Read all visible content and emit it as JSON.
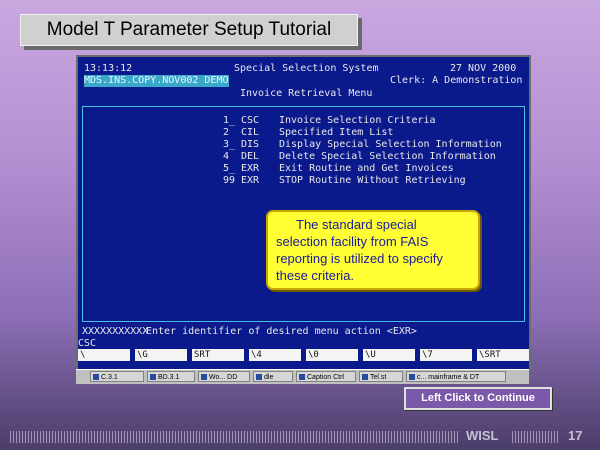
{
  "slide": {
    "title": "Model T Parameter Setup Tutorial",
    "continue_label": "Left Click to Continue",
    "footer_org": "WISL",
    "page_number": "17"
  },
  "terminal": {
    "time": "13:13:12",
    "system_title": "Special Selection System",
    "date": "27 NOV 2000",
    "session": "MDS.INS.COPY.NOV002 DEMO",
    "clerk": "Clerk: A Demonstration",
    "screen_title": "Invoice Retrieval Menu",
    "menu": [
      {
        "num": "1_",
        "code": "CSC",
        "desc": "Invoice Selection Criteria"
      },
      {
        "num": "2",
        "code": "CIL",
        "desc": "Specified Item List"
      },
      {
        "num": "3_",
        "code": "DIS",
        "desc": "Display Special Selection Information"
      },
      {
        "num": "4",
        "code": "DEL",
        "desc": "Delete Special Selection Information"
      },
      {
        "num": "5_",
        "code": "EXR",
        "desc": "Exit Routine and Get Invoices"
      },
      {
        "num": "99",
        "code": "EXR",
        "desc": "STOP Routine Without Retrieving"
      }
    ],
    "prompt_mask": "XXXXXXXXXXX",
    "prompt": "Enter identifier of desired menu action <EXR>",
    "input_value": "CSC",
    "fkeys": [
      "\\",
      "\\G",
      "SRT",
      "\\4",
      "\\0",
      "\\U",
      "\\7",
      "\\SRT"
    ]
  },
  "callout": {
    "text": "The standard special selection facility from FAIS reporting is utilized to specify these criteria."
  },
  "taskbar": {
    "items": [
      "C.3.1",
      "BD.3.1",
      "Wo... DD",
      "dle",
      "Caption Ctrl",
      "Tel.st",
      "c... mainframe & DT"
    ]
  },
  "colors": {
    "terminal_bg": "#0a1a8c",
    "callout_bg": "#ffff33",
    "callout_text": "#1a1a99",
    "highlight": "#3aa8c8"
  }
}
